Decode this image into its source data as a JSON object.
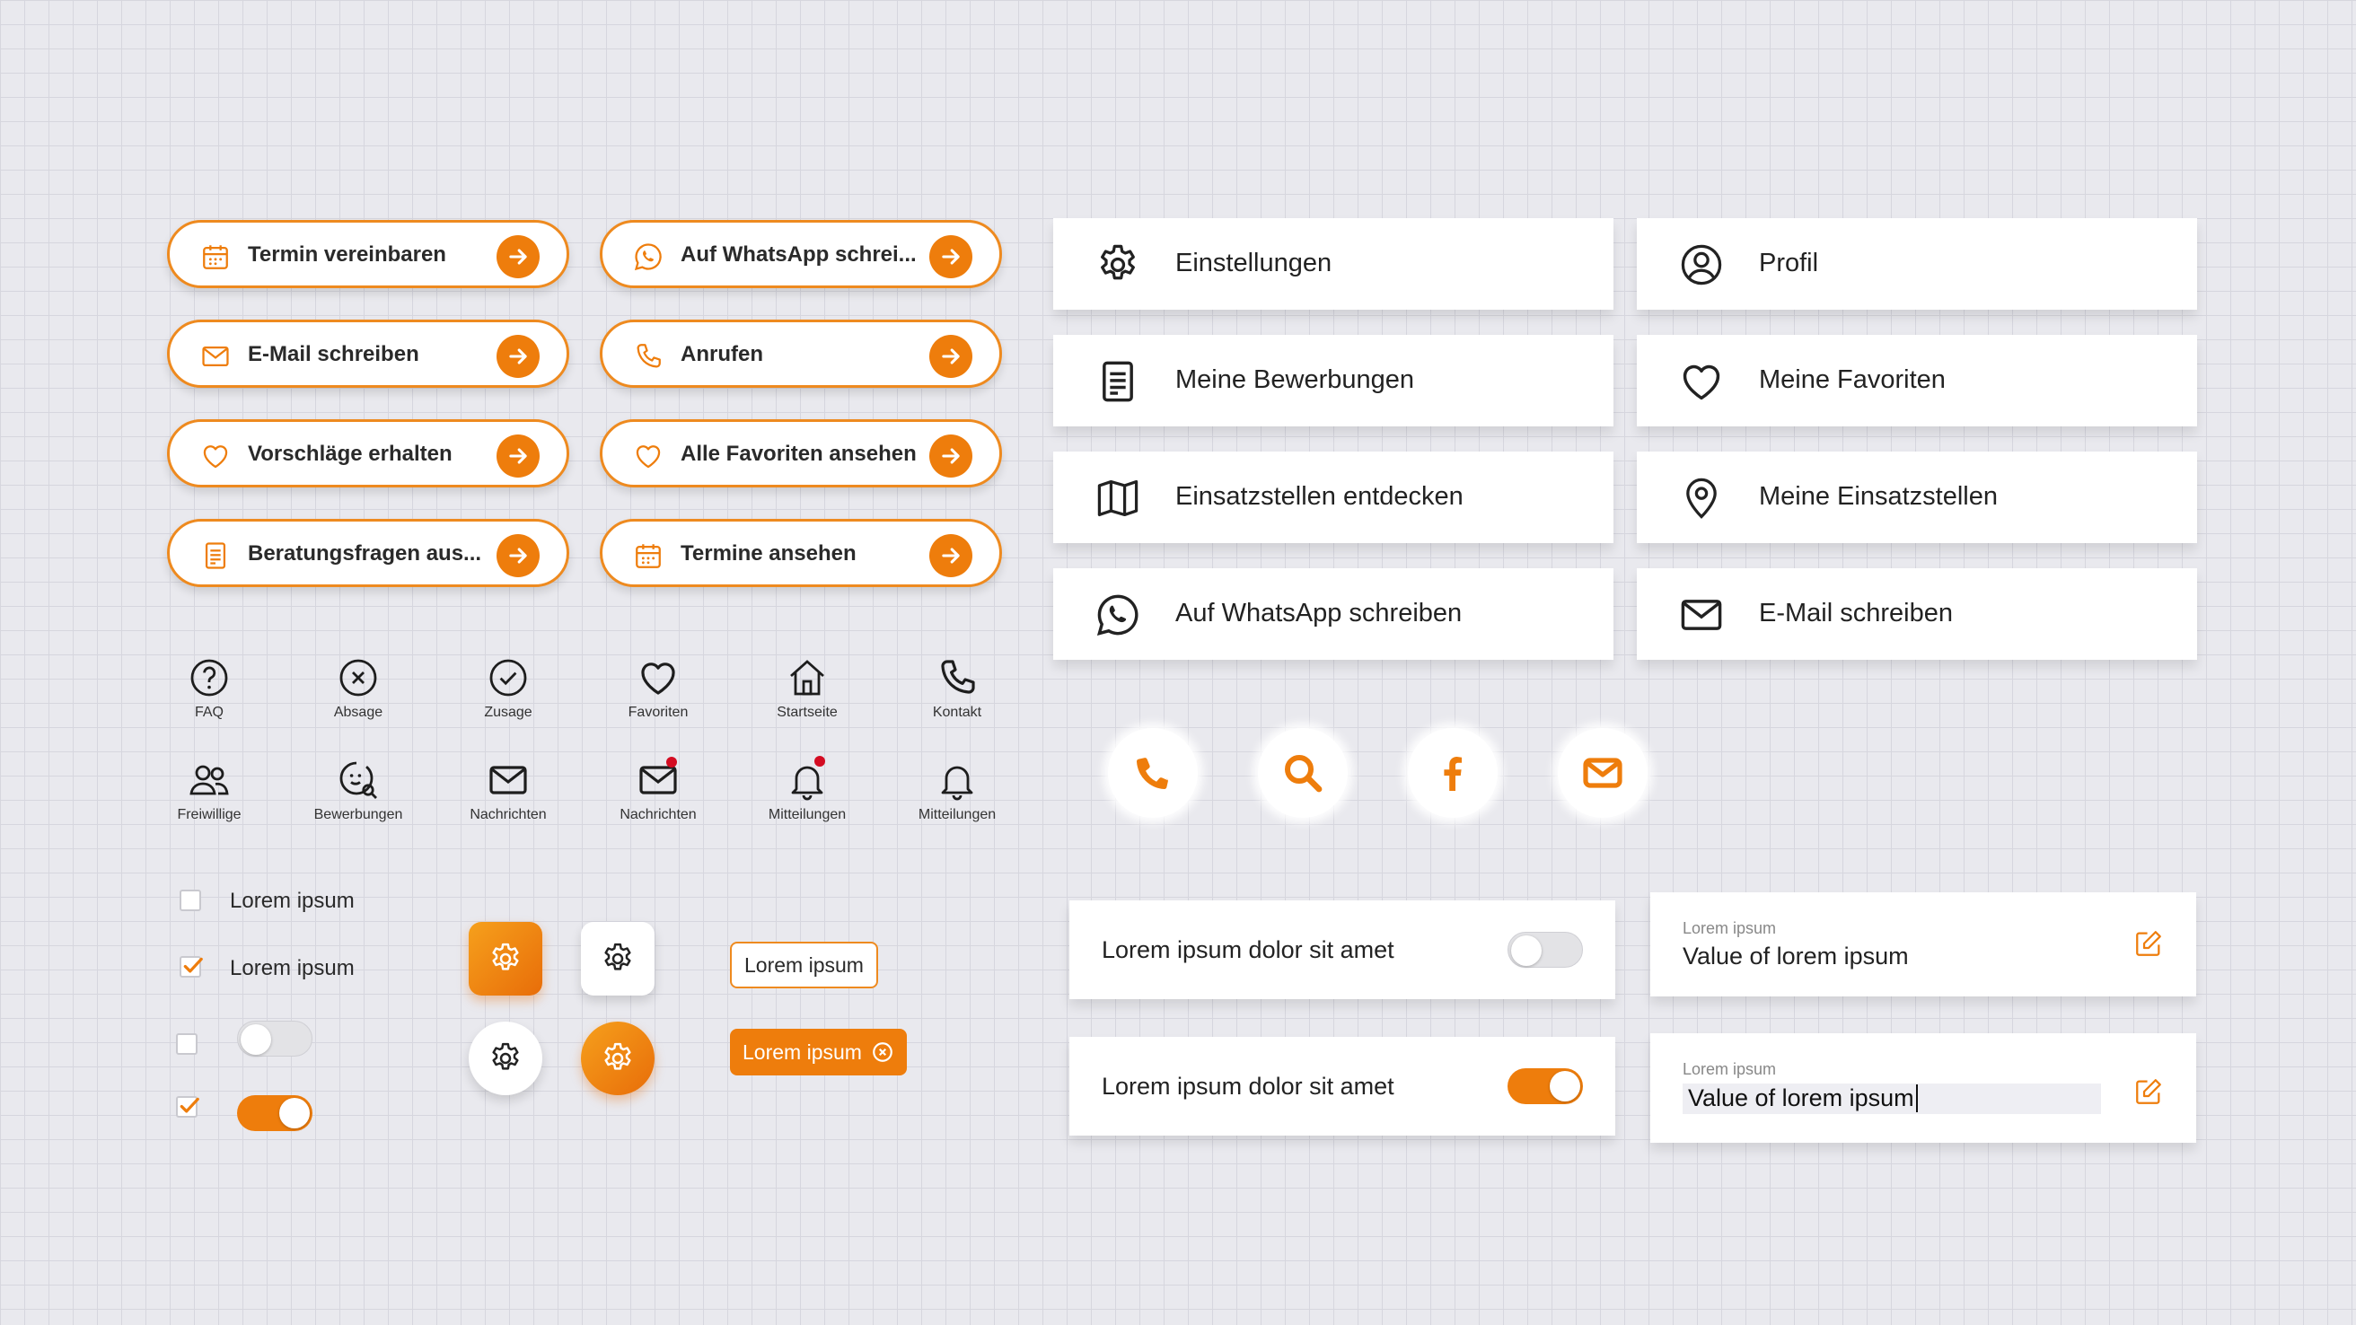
{
  "colors": {
    "accent": "#ee7d0c",
    "notification": "#d40c22"
  },
  "pill_buttons": [
    {
      "label": "Termin vereinbaren",
      "icon": "calendar-icon"
    },
    {
      "label": "Auf WhatsApp schrei...",
      "icon": "whatsapp-icon"
    },
    {
      "label": "E-Mail schreiben",
      "icon": "mail-icon"
    },
    {
      "label": "Anrufen",
      "icon": "phone-icon"
    },
    {
      "label": "Vorschläge erhalten",
      "icon": "heart-icon"
    },
    {
      "label": "Alle Favoriten ansehen",
      "icon": "heart-icon"
    },
    {
      "label": "Beratungsfragen aus...",
      "icon": "document-icon"
    },
    {
      "label": "Termine ansehen",
      "icon": "calendar-icon"
    }
  ],
  "menu_cards": [
    {
      "label": "Einstellungen",
      "icon": "gear-icon"
    },
    {
      "label": "Profil",
      "icon": "user-icon"
    },
    {
      "label": "Meine Bewerbungen",
      "icon": "document-icon"
    },
    {
      "label": "Meine Favoriten",
      "icon": "heart-icon"
    },
    {
      "label": "Einsatzstellen entdecken",
      "icon": "map-icon"
    },
    {
      "label": "Meine Einsatzstellen",
      "icon": "location-pin-icon"
    },
    {
      "label": "Auf WhatsApp schreiben",
      "icon": "whatsapp-icon"
    },
    {
      "label": "E-Mail schreiben",
      "icon": "mail-icon"
    }
  ],
  "icon_grid": [
    {
      "label": "FAQ",
      "icon": "question-icon"
    },
    {
      "label": "Absage",
      "icon": "x-circle-icon"
    },
    {
      "label": "Zusage",
      "icon": "check-circle-icon"
    },
    {
      "label": "Favoriten",
      "icon": "heart-icon"
    },
    {
      "label": "Startseite",
      "icon": "home-icon"
    },
    {
      "label": "Kontakt",
      "icon": "phone-icon"
    },
    {
      "label": "Freiwillige",
      "icon": "users-icon"
    },
    {
      "label": "Bewerbungen",
      "icon": "search-face-icon"
    },
    {
      "label": "Nachrichten",
      "icon": "mail-icon"
    },
    {
      "label": "Nachrichten",
      "icon": "mail-notification-icon"
    },
    {
      "label": "Mitteilungen",
      "icon": "bell-notification-icon"
    },
    {
      "label": "Mitteilungen",
      "icon": "bell-icon"
    }
  ],
  "social": [
    "phone-icon",
    "search-icon",
    "facebook-icon",
    "mail-icon"
  ],
  "checkboxes": [
    {
      "label": "Lorem ipsum",
      "checked": false
    },
    {
      "label": "Lorem ipsum",
      "checked": true
    }
  ],
  "tags": {
    "outline": "Lorem ipsum",
    "filled": "Lorem ipsum"
  },
  "settings": [
    {
      "label": "Lorem ipsum dolor sit amet",
      "on": false
    },
    {
      "label": "Lorem ipsum dolor sit amet",
      "on": true
    }
  ],
  "fields": [
    {
      "label": "Lorem ipsum",
      "value": "Value of lorem ipsum"
    },
    {
      "label": "Lorem ipsum",
      "value": "Value of lorem ipsum"
    }
  ]
}
